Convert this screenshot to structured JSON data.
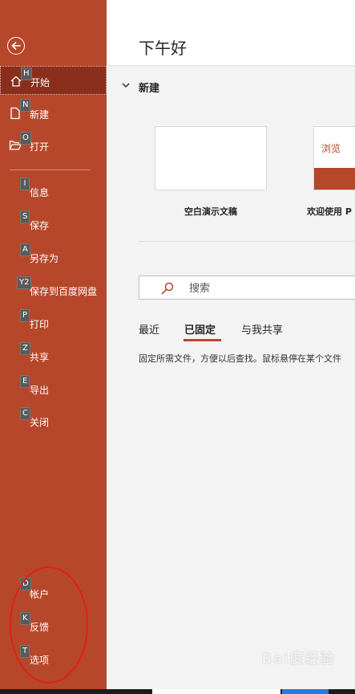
{
  "sidebar": {
    "items": [
      {
        "label": "开始",
        "key": "H"
      },
      {
        "label": "新建",
        "key": "N"
      },
      {
        "label": "打开",
        "key": "O"
      },
      {
        "label": "信息",
        "key": "I"
      },
      {
        "label": "保存",
        "key": "S"
      },
      {
        "label": "另存为",
        "key": "A"
      },
      {
        "label": "保存到百度网盘",
        "key": "Y2"
      },
      {
        "label": "打印",
        "key": "P"
      },
      {
        "label": "共享",
        "key": "Z"
      },
      {
        "label": "导出",
        "key": "E"
      },
      {
        "label": "关闭",
        "key": "C"
      }
    ],
    "bottom_items": [
      {
        "label": "帐户",
        "key": "D"
      },
      {
        "label": "反馈",
        "key": "K"
      },
      {
        "label": "选项",
        "key": "T"
      }
    ]
  },
  "main": {
    "greeting": "下午好",
    "new_section": "新建",
    "templates": [
      {
        "label": "空白演示文稿"
      },
      {
        "label": "欢迎使用 P",
        "thumb_text": "浏览"
      }
    ],
    "search_placeholder": "搜索",
    "tabs": [
      "最近",
      "已固定",
      "与我共享"
    ],
    "active_tab": "已固定",
    "pinned_hint": "固定所需文件，方便以后查找。鼠标悬停在某个文件"
  },
  "watermark": "Bai度经验",
  "colors": {
    "accent": "#b7472a",
    "active_item": "#8a2f1c",
    "annotation": "#e21d1d"
  }
}
